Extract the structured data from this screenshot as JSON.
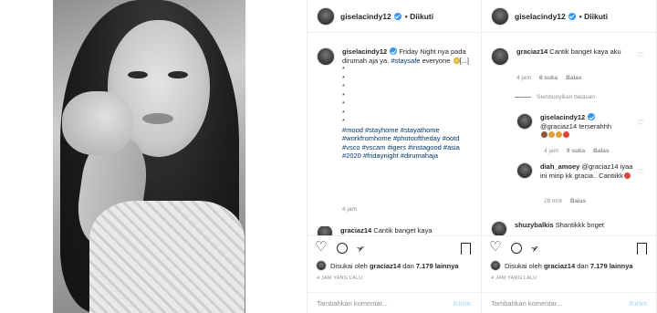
{
  "post": {
    "username": "giselacindy12",
    "follow_label": "• Diikuti",
    "caption_text": "Friday Night nya pada dirumah aja ya.",
    "caption_tag_inline": "#staysafe",
    "caption_end": "everyone",
    "more": "[...]",
    "dots": [
      "*",
      "*",
      "*",
      "*",
      "*",
      "*",
      "*"
    ],
    "hashtags": "#mood #stayhome #stayathome #workfromhome #photooftheday #ootd #vsco #vscam #igers #instagood #asia #2020 #fridaynight #dirumahaja",
    "time": "4 jam",
    "peek_comment_user": "graciaz14",
    "peek_comment_text": "Cantik banget kaya",
    "liked_by_prefix": "Disukai oleh",
    "liked_by_user": "graciaz14",
    "liked_by_and": "dan",
    "liked_count": "7.179 lainnya",
    "timestamp": "4 JAM YANG LALU",
    "add_comment_placeholder": "Tambahkan komentar...",
    "send_label": "Kirim"
  },
  "comments": [
    {
      "user": "graciaz14",
      "text": "Cantik banget kaya aku",
      "time": "4 jam",
      "likes": "8 suka",
      "reply": "Balas"
    },
    {
      "user": "giselacindy12",
      "text": "@graciaz14 terserahhh",
      "time": "4 jam",
      "likes": "9 suka",
      "reply": "Balas"
    },
    {
      "user": "diah_amoey",
      "text": "@graciaz14 iyaa ini mirip kk gracia.. Cantiikk",
      "time": "28 mnt",
      "reply": "Balas"
    },
    {
      "user": "shuzybalkis",
      "text": "Shantikkk bnget"
    }
  ],
  "hide_replies_label": "Sembunyikan balasan",
  "colors": {
    "link": "#00376b",
    "verified": "#3897f0",
    "muted": "#8e8e8e",
    "send_disabled": "#b2dffc"
  }
}
